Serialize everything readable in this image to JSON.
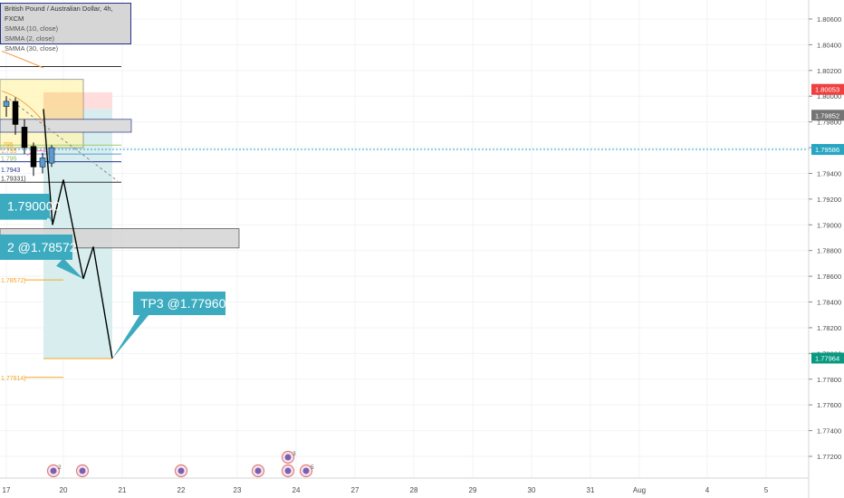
{
  "symbol_title": "British Pound / Australian Dollar, 4h, FXCM",
  "indicators": [
    "SMMA (10, close)",
    "SMMA (2, close)",
    "SMMA (30, close)"
  ],
  "colors": {
    "candle": "#000000",
    "candle_bull": "#5b9bd5",
    "current_price": "#747474",
    "current_price_upper": "#ef3f3f",
    "current_price_line": "#26a6c1",
    "target": "#089981",
    "callout": "#3cabbf",
    "tp_zone": "#d4ecec",
    "stop_zone": "#ffd9d9",
    "yellow_zone": "#fff6b3",
    "orange_label": "#f5a623",
    "grid": "#f1f3f6",
    "axis_text": "#4a4a4a"
  },
  "chart_data": {
    "type": "candlestick",
    "y_axis": {
      "ticks": [
        "1.80600",
        "1.80400",
        "1.80200",
        "1.80000",
        "1.79800",
        "1.79600",
        "1.79400",
        "1.79200",
        "1.79000",
        "1.78800",
        "1.78600",
        "1.78400",
        "1.78200",
        "1.78000",
        "1.77800",
        "1.77600",
        "1.77400",
        "1.77200"
      ],
      "tick_values": [
        1.806,
        1.804,
        1.802,
        1.8,
        1.798,
        1.796,
        1.794,
        1.792,
        1.79,
        1.788,
        1.786,
        1.784,
        1.782,
        1.78,
        1.778,
        1.776,
        1.774,
        1.772
      ],
      "range": [
        1.7706,
        1.8082
      ]
    },
    "x_axis": {
      "ticks": [
        "17",
        "20",
        "21",
        "22",
        "23",
        "24",
        "27",
        "28",
        "29",
        "30",
        "31",
        "Aug",
        "4",
        "5"
      ]
    },
    "price_labels": [
      {
        "label": "1.80053",
        "value": 1.80053,
        "color": "#ef3f3f"
      },
      {
        "label": "1.79852",
        "value": 1.79852,
        "color": "#747474"
      },
      {
        "label": "1.79586",
        "value": 1.79586,
        "color": "#26a6c1"
      },
      {
        "label": "1.77964",
        "value": 1.77964,
        "color": "#089981"
      }
    ],
    "candles": [
      {
        "o": 1.7992,
        "h": 1.8,
        "l": 1.7984,
        "c": 1.7996
      },
      {
        "o": 1.7996,
        "h": 1.7999,
        "l": 1.797,
        "c": 1.7978
      },
      {
        "o": 1.7976,
        "h": 1.7982,
        "l": 1.7955,
        "c": 1.796
      },
      {
        "o": 1.7961,
        "h": 1.7964,
        "l": 1.7938,
        "c": 1.7945
      },
      {
        "o": 1.7945,
        "h": 1.7956,
        "l": 1.794,
        "c": 1.7952
      },
      {
        "o": 1.7948,
        "h": 1.7962,
        "l": 1.7945,
        "c": 1.796
      }
    ],
    "projection": [
      1.799,
      1.79,
      1.7935,
      1.7858,
      1.7883,
      1.7796
    ],
    "levels": [
      {
        "label": "1.79331)",
        "value": 1.79331
      },
      {
        "label": "1.78572)",
        "value": 1.78572
      },
      {
        "label": "1.77814)",
        "value": 1.77814
      }
    ],
    "small_labels": [
      ".795",
      "1.795",
      "1.795",
      "1.7943"
    ],
    "callouts": [
      {
        "label": "1.790000",
        "value": 1.79
      },
      {
        "label": "2 @1.78572",
        "value": 1.78572
      },
      {
        "label": "TP3 @1.77960",
        "value": 1.7796
      }
    ],
    "events": [
      {
        "x_label": "20",
        "count": "2"
      },
      {
        "x_label": "20",
        "count": ""
      },
      {
        "x_label": "22",
        "count": ""
      },
      {
        "x_label": "23",
        "count": ""
      },
      {
        "x_label": "24",
        "count": "3"
      },
      {
        "x_label": "24",
        "count": ""
      },
      {
        "x_label": "24",
        "count": "5"
      }
    ]
  }
}
